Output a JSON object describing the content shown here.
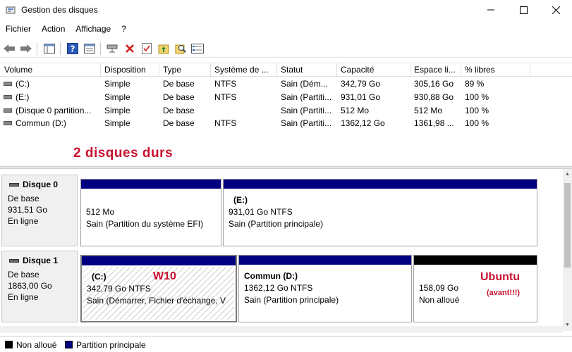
{
  "window": {
    "title": "Gestion des disques",
    "icon": "disk-management-icon"
  },
  "menu": [
    "Fichier",
    "Action",
    "Affichage",
    "?"
  ],
  "toolbar": {
    "icons": [
      "back-arrow-icon",
      "forward-arrow-icon",
      "console-tree-icon",
      "help-icon",
      "properties-icon",
      "connect-icon",
      "delete-icon",
      "check-icon",
      "folder-up-icon",
      "search-icon",
      "list-view-icon"
    ]
  },
  "volumes": {
    "columns": [
      "Volume",
      "Disposition",
      "Type",
      "Système de ...",
      "Statut",
      "Capacité",
      "Espace li...",
      "% libres"
    ],
    "rows": [
      [
        "(C:)",
        "Simple",
        "De base",
        "NTFS",
        "Sain (Dém...",
        "342,79 Go",
        "305,16 Go",
        "89 %"
      ],
      [
        "(E:)",
        "Simple",
        "De base",
        "NTFS",
        "Sain (Partiti...",
        "931,01 Go",
        "930,88 Go",
        "100 %"
      ],
      [
        "(Disque 0 partition...",
        "Simple",
        "De base",
        "",
        "Sain (Partiti...",
        "512 Mo",
        "512 Mo",
        "100 %"
      ],
      [
        "Commun (D:)",
        "Simple",
        "De base",
        "NTFS",
        "Sain (Partiti...",
        "1362,12 Go",
        "1361,98 ...",
        "100 %"
      ]
    ]
  },
  "annotations": {
    "two_disks": "2 disques durs",
    "w10": "W10",
    "ubuntu": "Ubuntu",
    "ubuntu_sub": "(avant!!!)"
  },
  "disks": [
    {
      "name": "Disque 0",
      "type": "De base",
      "size": "931,51 Go",
      "status": "En ligne",
      "partitions": [
        {
          "label": "",
          "size": "512 Mo",
          "status": "Sain (Partition du système EFI)",
          "kind": "primary"
        },
        {
          "label": "(E:)",
          "size": "931,01 Go NTFS",
          "status": "Sain (Partition principale)",
          "kind": "primary"
        }
      ]
    },
    {
      "name": "Disque 1",
      "type": "De base",
      "size": "1863,00 Go",
      "status": "En ligne",
      "partitions": [
        {
          "label": "(C:)",
          "size": "342,79 Go NTFS",
          "status": "Sain (Démarrer, Fichier d'échange, V",
          "kind": "primary"
        },
        {
          "label": "Commun  (D:)",
          "size": "1362,12 Go NTFS",
          "status": "Sain (Partition principale)",
          "kind": "primary"
        },
        {
          "label": "",
          "size": "158,09 Go",
          "status": "Non alloué",
          "kind": "unallocated"
        }
      ]
    }
  ],
  "legend": [
    {
      "label": "Non alloué",
      "color": "#000000"
    },
    {
      "label": "Partition principale",
      "color": "#000080"
    }
  ],
  "colors": {
    "primary": "#000080",
    "unallocated": "#000000",
    "annotation": "#c8102e"
  }
}
